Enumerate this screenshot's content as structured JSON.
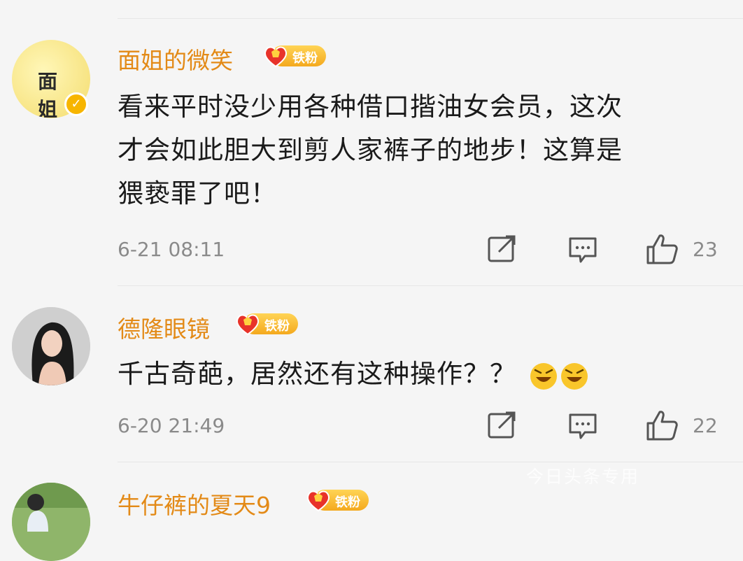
{
  "comments": [
    {
      "username": "面姐的微笑",
      "badge": "铁粉",
      "avatar_text": "面 姐",
      "text_lines": [
        "看来平时没少用各种借口揩油女会员，这次",
        "才会如此胆大到剪人家裤子的地步！这算是",
        "猥亵罪了吧！"
      ],
      "time": "6-21 08:11",
      "likes": "23"
    },
    {
      "username": "德隆眼镜",
      "badge": "铁粉",
      "text": "千古奇葩，居然还有这种操作？？",
      "time": "6-20 21:49",
      "likes": "22"
    },
    {
      "username": "牛仔裤的夏天9",
      "badge": "铁粉"
    }
  ],
  "watermark": "今日头条专用",
  "icons": [
    "share-icon",
    "reply-icon",
    "like-icon",
    "verified-icon",
    "fan-badge-icon",
    "laugh-emoji"
  ],
  "colors": {
    "username": "#e38a17",
    "badge": "#f4a91e",
    "meta": "#8a8a8a",
    "background": "#f5f5f5"
  }
}
